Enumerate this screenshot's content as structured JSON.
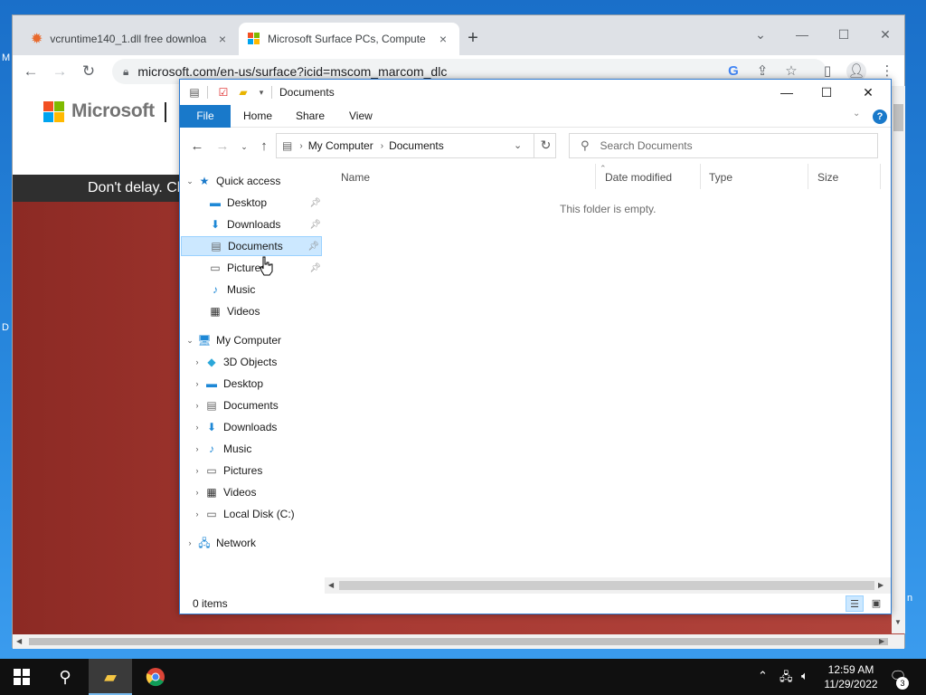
{
  "desktop": {
    "edge_left_top": "M",
    "edge_left_mid": "D",
    "edge_right_low": "n"
  },
  "chrome": {
    "tabs": [
      {
        "title": "vcruntime140_1.dll free downloa",
        "icon": "orange-gear-icon",
        "active": false
      },
      {
        "title": "Microsoft Surface PCs, Compute",
        "icon": "microsoft-logo-icon",
        "active": true
      }
    ],
    "new_tab_label": "+",
    "url": "microsoft.com/en-us/surface?icid=mscom_marcom_dlc",
    "window_controls": {
      "minimize": "—",
      "maximize": "☐",
      "close": "✕",
      "tab_search": "⌄"
    }
  },
  "webpage": {
    "brand": "Microsoft",
    "promo_text": "Don't delay. Clic",
    "logo_colors": [
      "#f25022",
      "#7fba00",
      "#00a4ef",
      "#ffb900"
    ]
  },
  "explorer": {
    "title": "Documents",
    "ribbon_tabs": [
      "File",
      "Home",
      "Share",
      "View"
    ],
    "help_label": "?",
    "address": {
      "root": "My Computer",
      "current": "Documents"
    },
    "search_placeholder": "Search Documents",
    "quick_access_label": "Quick access",
    "quick_access": [
      {
        "label": "Desktop",
        "icon": "desktop-icon",
        "pinned": true
      },
      {
        "label": "Downloads",
        "icon": "downloads-icon",
        "pinned": true
      },
      {
        "label": "Documents",
        "icon": "documents-icon",
        "pinned": true,
        "selected": true
      },
      {
        "label": "Pictures",
        "icon": "pictures-icon",
        "pinned": true
      },
      {
        "label": "Music",
        "icon": "music-icon",
        "pinned": false
      },
      {
        "label": "Videos",
        "icon": "videos-icon",
        "pinned": false
      }
    ],
    "computer_label": "My Computer",
    "computer_items": [
      {
        "label": "3D Objects",
        "icon": "3d-objects-icon"
      },
      {
        "label": "Desktop",
        "icon": "desktop-icon"
      },
      {
        "label": "Documents",
        "icon": "documents-icon"
      },
      {
        "label": "Downloads",
        "icon": "downloads-icon"
      },
      {
        "label": "Music",
        "icon": "music-icon"
      },
      {
        "label": "Pictures",
        "icon": "pictures-icon"
      },
      {
        "label": "Videos",
        "icon": "videos-icon"
      },
      {
        "label": "Local Disk (C:)",
        "icon": "local-disk-icon"
      }
    ],
    "network_label": "Network",
    "columns": [
      "Name",
      "Date modified",
      "Type",
      "Size"
    ],
    "empty_message": "This folder is empty.",
    "status_count": "0 items",
    "accent": "#1979ca"
  },
  "taskbar": {
    "time": "12:59 AM",
    "date": "11/29/2022",
    "notification_count": "3"
  }
}
